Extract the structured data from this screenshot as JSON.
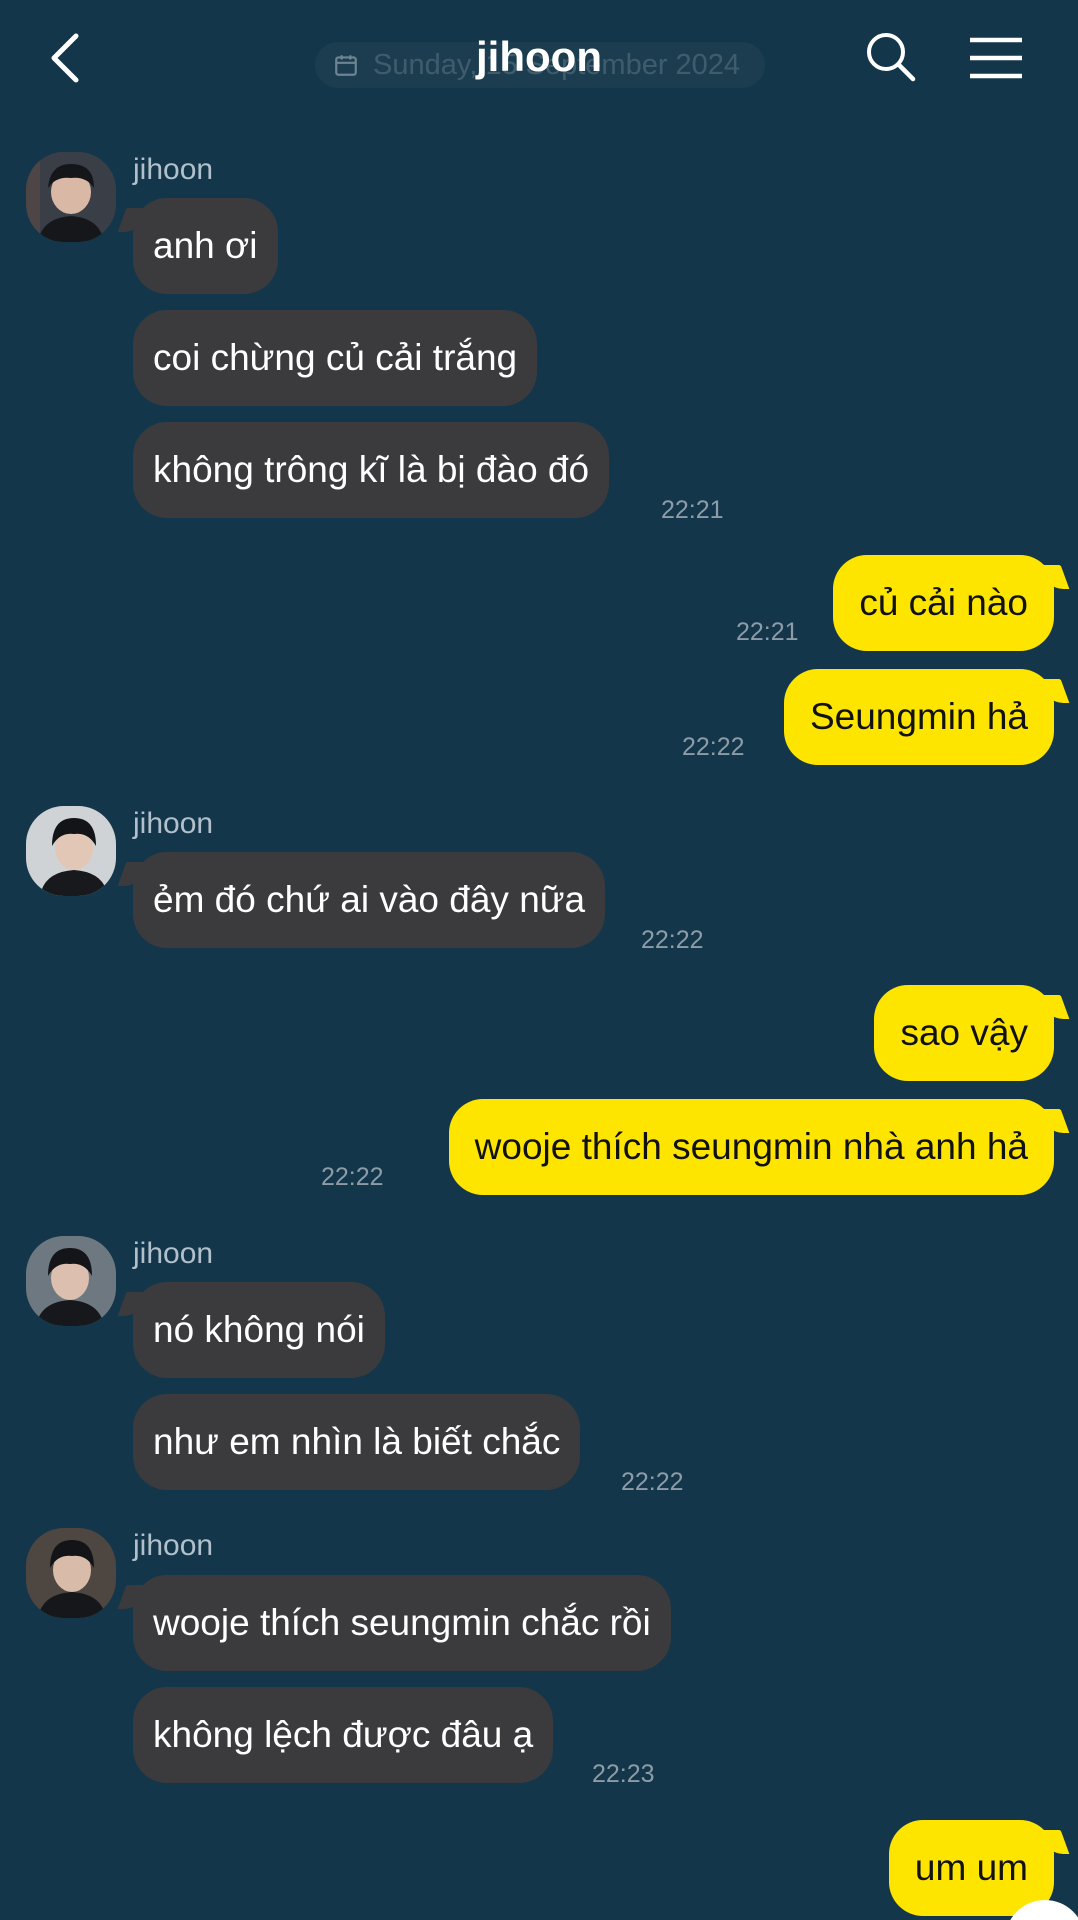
{
  "header": {
    "title": "jihoon",
    "date_banner": "Sunday, 15 September 2024"
  },
  "colors": {
    "background": "#13364a",
    "incoming_bubble": "#3b3b3d",
    "outgoing_bubble": "#fee500",
    "timestamp": "#8d9ca7"
  },
  "icons": {
    "back": "chevron-left-icon",
    "search": "search-icon",
    "menu": "hamburger-menu-icon",
    "calendar": "calendar-icon"
  },
  "messages": [
    {
      "sender": "jihoon",
      "text": "anh ơi"
    },
    {
      "sender": "jihoon",
      "text": "coi chừng củ cải trắng"
    },
    {
      "sender": "jihoon",
      "text": "không trông kĩ là bị đào đó",
      "time": "22:21"
    },
    {
      "sender": "me",
      "text": "củ cải nào",
      "time": "22:21"
    },
    {
      "sender": "me",
      "text": "Seungmin hả",
      "time": "22:22"
    },
    {
      "sender": "jihoon",
      "text": "ẻm đó chứ ai vào đây nữa",
      "time": "22:22"
    },
    {
      "sender": "me",
      "text": "sao vậy"
    },
    {
      "sender": "me",
      "text": "wooje thích seungmin nhà anh hả",
      "time": "22:22"
    },
    {
      "sender": "jihoon",
      "text": "nó không nói"
    },
    {
      "sender": "jihoon",
      "text": "như em nhìn là biết chắc",
      "time": "22:22"
    },
    {
      "sender": "jihoon",
      "text": "wooje thích seungmin chắc rồi"
    },
    {
      "sender": "jihoon",
      "text": "không lệch được đâu ạ",
      "time": "22:23"
    },
    {
      "sender": "me",
      "text": "um um"
    }
  ],
  "sender_name": "jihoon"
}
